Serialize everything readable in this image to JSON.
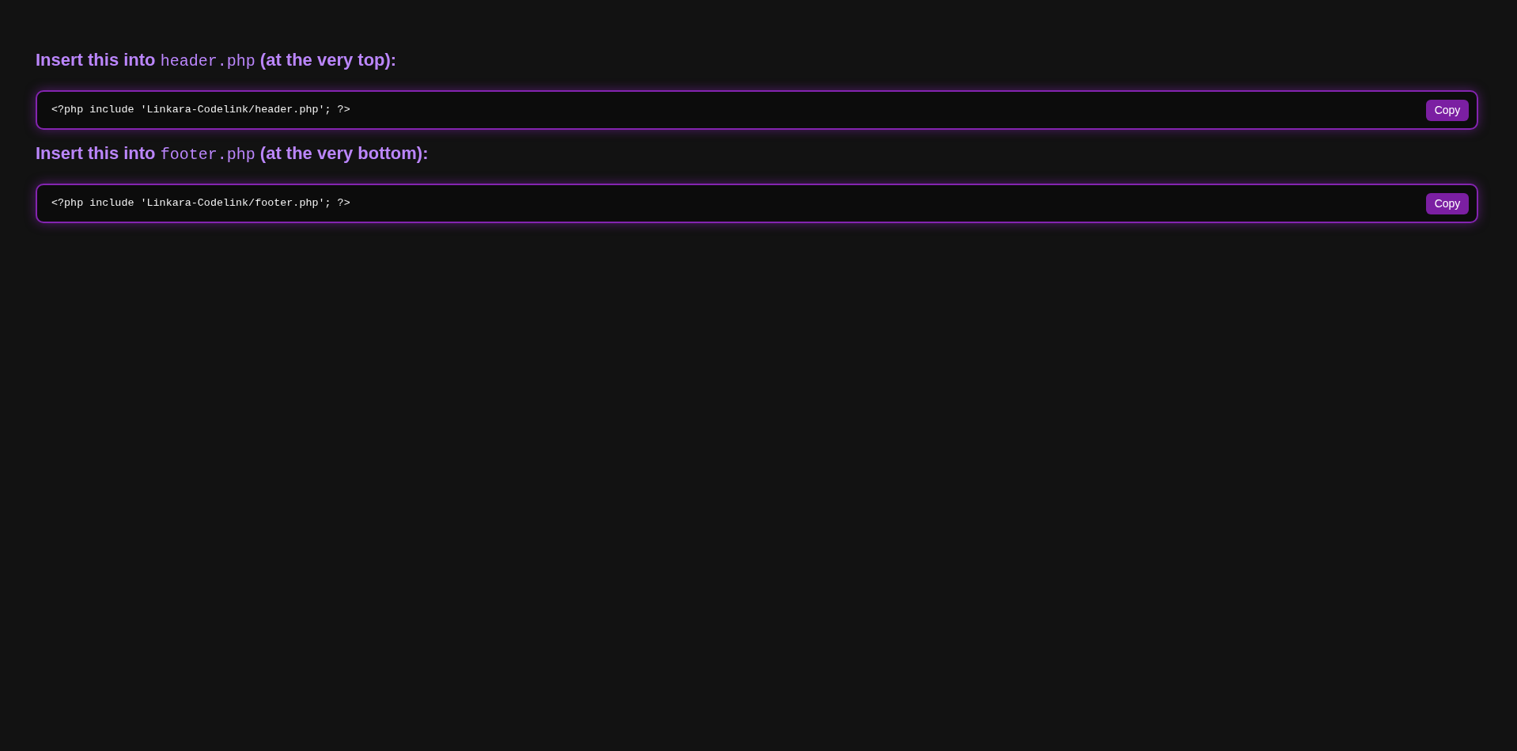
{
  "sections": [
    {
      "heading": {
        "before": "Insert this into",
        "file": "header.php",
        "after": "(at the very top):"
      },
      "code": "<?php include 'Linkara-Codelink/header.php'; ?>",
      "button": "Copy"
    },
    {
      "heading": {
        "before": "Insert this into",
        "file": "footer.php",
        "after": "(at the very bottom):"
      },
      "code": "<?php include 'Linkara-Codelink/footer.php'; ?>",
      "button": "Copy"
    }
  ]
}
